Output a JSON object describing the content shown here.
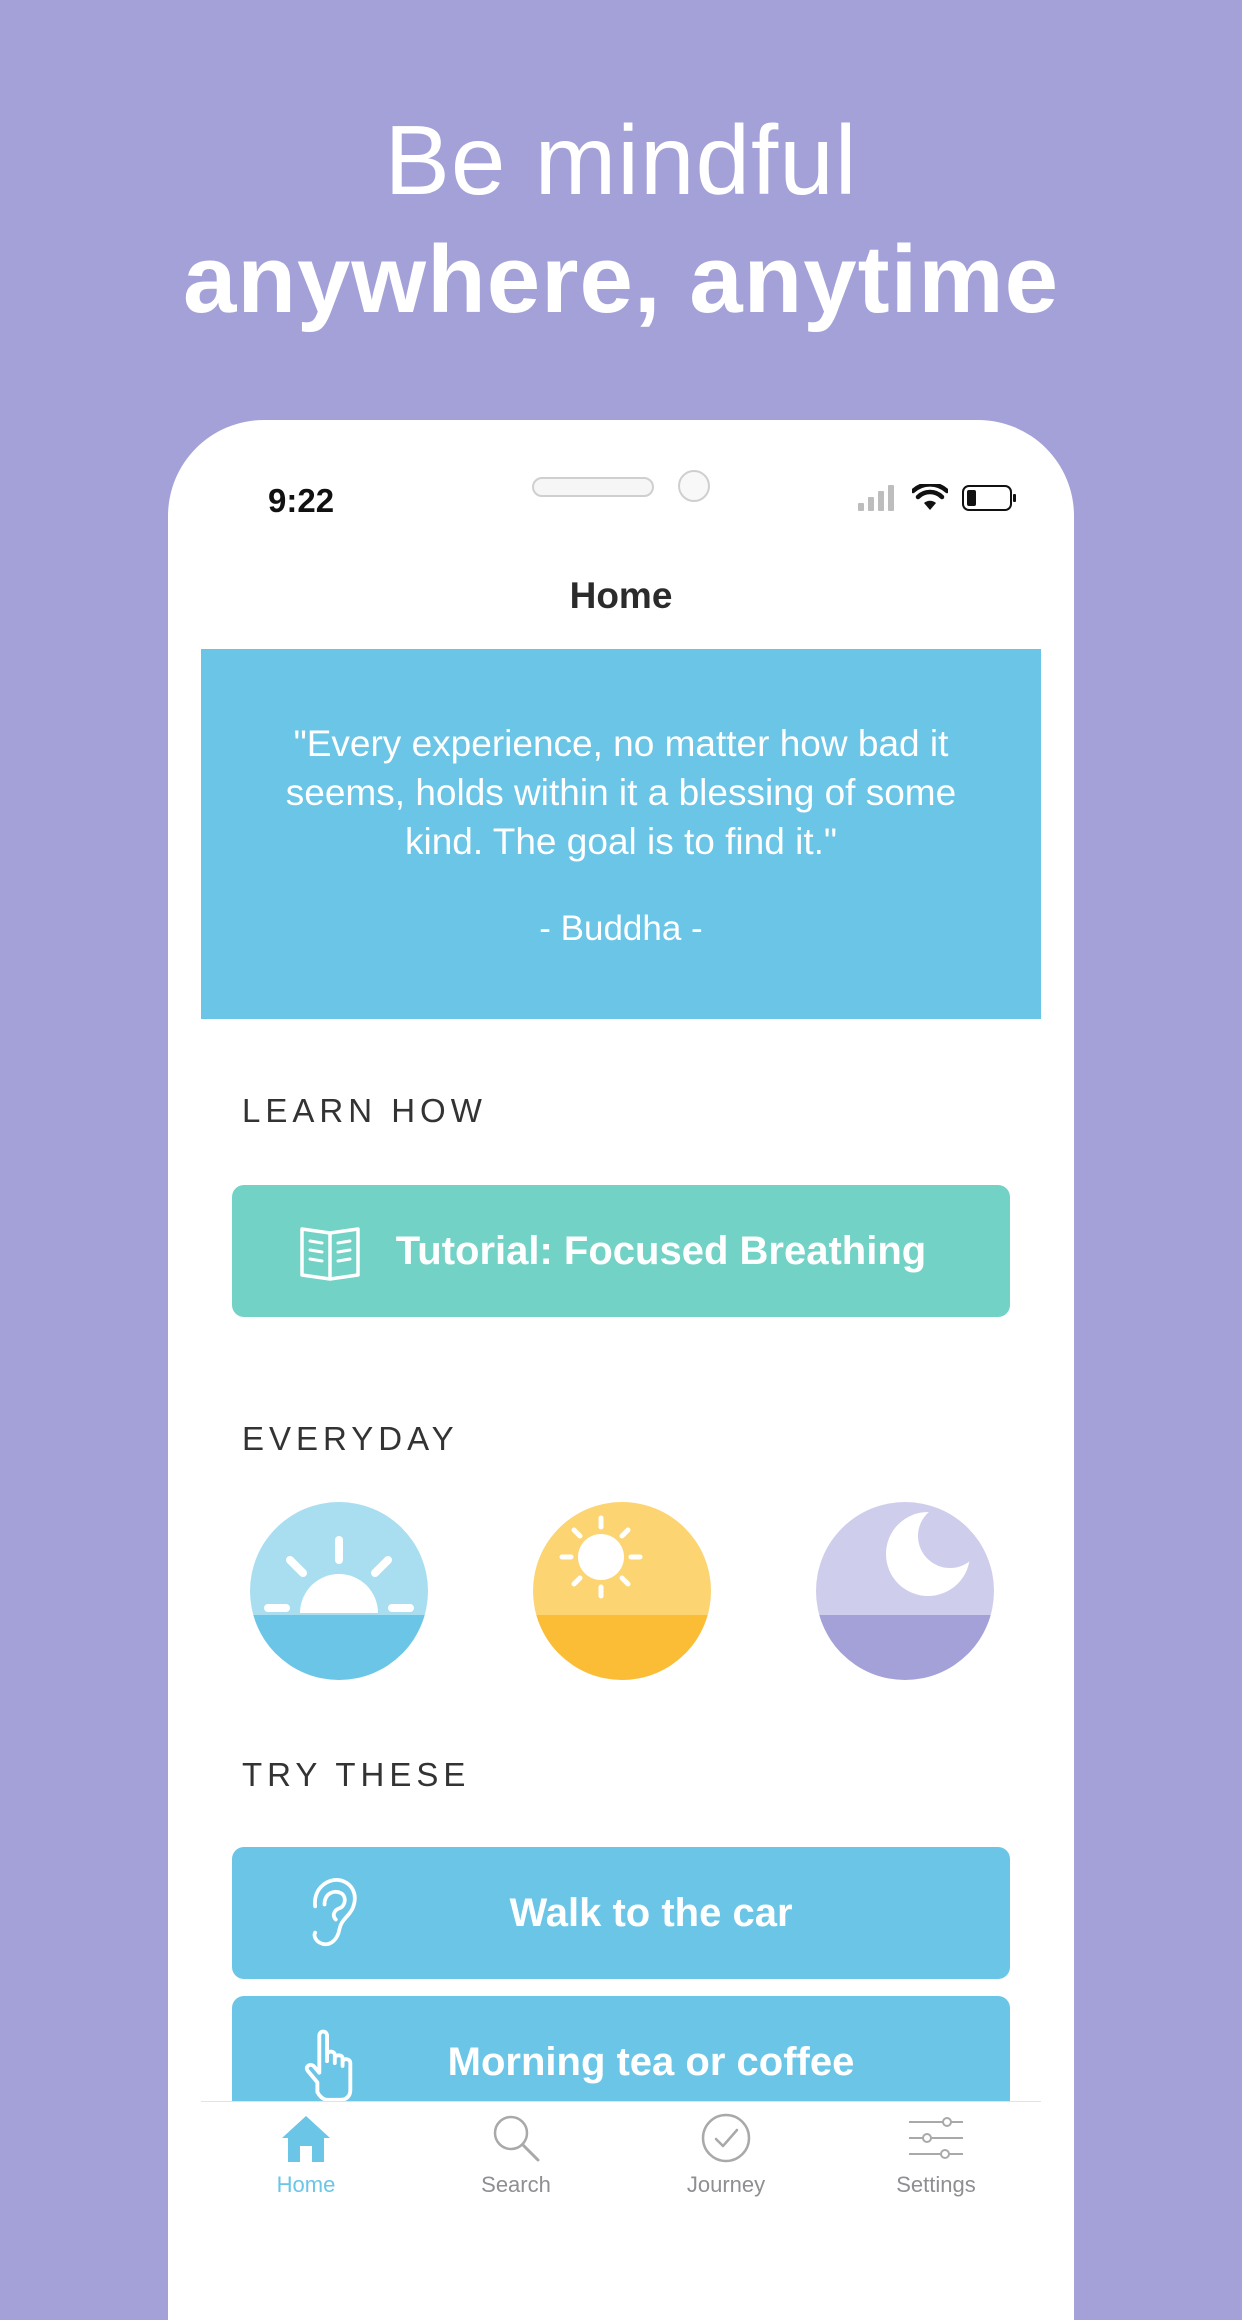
{
  "headline": {
    "line1": "Be mindful",
    "line2": "anywhere, anytime"
  },
  "status_bar": {
    "time": "9:22",
    "icons": [
      "cellular-signal-icon",
      "wifi-icon",
      "battery-icon"
    ]
  },
  "nav": {
    "title": "Home"
  },
  "quote": {
    "text": "\"Every experience, no matter how bad it seems, holds within it a blessing of some kind. The goal is to find it.\"",
    "author": "- Buddha -"
  },
  "learn_how": {
    "label": "LEARN HOW",
    "tutorial": {
      "label": "Tutorial: Focused Breathing",
      "icon": "book-icon"
    }
  },
  "everyday": {
    "label": "EVERYDAY",
    "items": [
      {
        "icon": "sunrise-icon"
      },
      {
        "icon": "sun-icon"
      },
      {
        "icon": "moon-icon"
      }
    ]
  },
  "try_these": {
    "label": "TRY THESE",
    "items": [
      {
        "label": "Walk to the car",
        "icon": "ear-icon"
      },
      {
        "label": "Morning tea or coffee",
        "icon": "pointing-hand-icon"
      }
    ]
  },
  "tabbar": {
    "tabs": [
      {
        "label": "Home",
        "icon": "home-icon",
        "active": true
      },
      {
        "label": "Search",
        "icon": "search-icon",
        "active": false
      },
      {
        "label": "Journey",
        "icon": "checkmark-circle-icon",
        "active": false
      },
      {
        "label": "Settings",
        "icon": "sliders-icon",
        "active": false
      }
    ]
  },
  "colors": {
    "background": "#a3a1d8",
    "quote_card": "#6ac5e6",
    "tutorial_button": "#72d2c6",
    "activity_button": "#6ac5e6",
    "active_tab": "#6ac5e6",
    "sunrise_top": "#a9def1",
    "sunrise_bottom": "#6ac5e6",
    "sun_top": "#fcd471",
    "sun_bottom": "#fbbd36",
    "moon_top": "#cfcdec",
    "moon_bottom": "#a3a1d8"
  }
}
